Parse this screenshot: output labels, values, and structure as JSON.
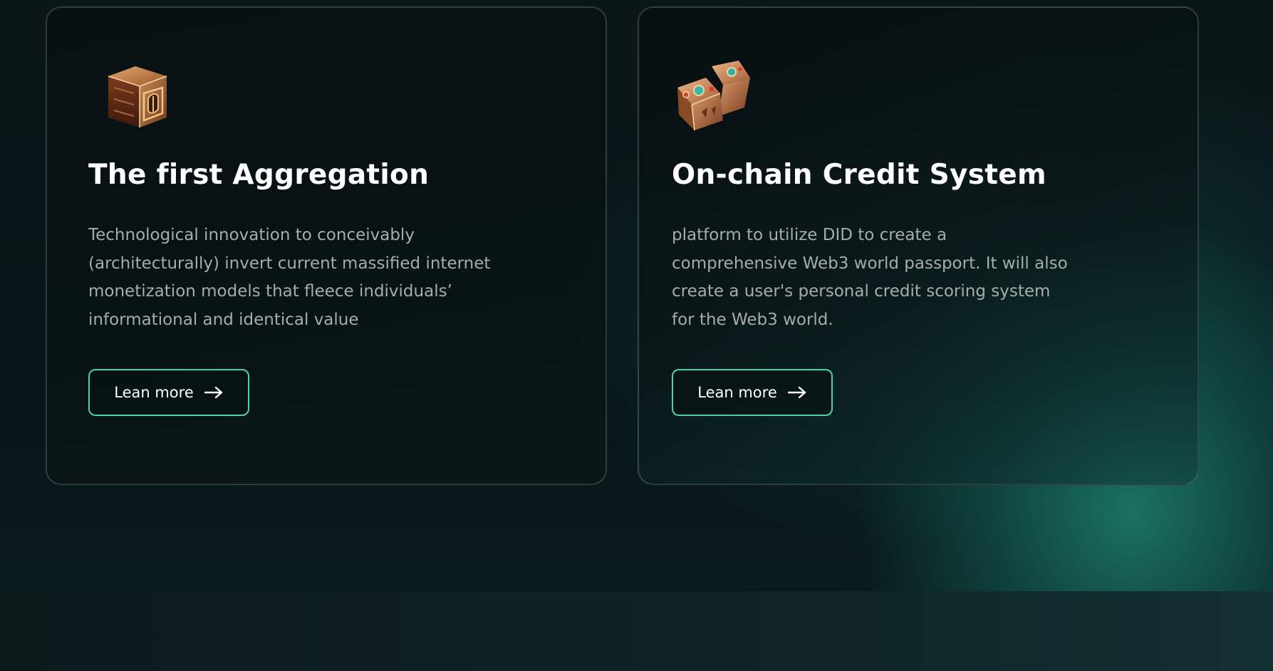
{
  "cards": [
    {
      "title": "The first Aggregation",
      "description_lines": [
        "Technological innovation to conceivably",
        "(architecturally) invert current massified internet",
        "monetization models that fleece individuals’",
        "informational and identical value"
      ],
      "button_label": "Lean more",
      "icon": "ornate-cube-icon"
    },
    {
      "title": "On-chain Credit System",
      "description_lines": [
        "platform to utilize DID to create a",
        "comprehensive Web3 world passport. It will also",
        "create a user's personal credit scoring system",
        "for the Web3 world."
      ],
      "button_label": "Lean more",
      "icon": "jeweled-dice-icon"
    }
  ],
  "colors": {
    "accent": "#4fd1a8",
    "background": "#071214",
    "title": "#ffffff",
    "description": "#a6acab"
  }
}
